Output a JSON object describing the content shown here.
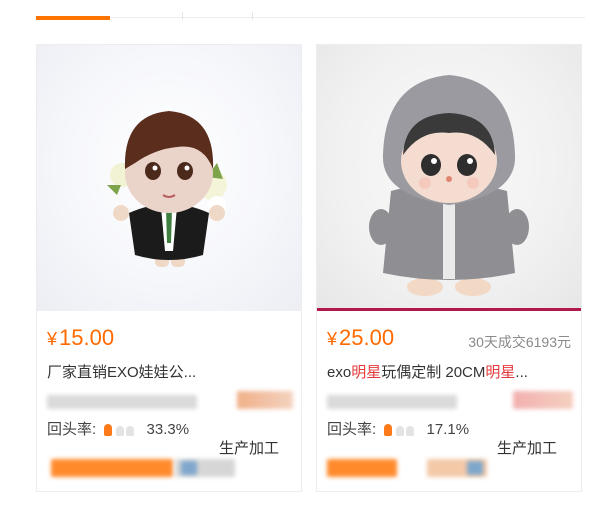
{
  "products": [
    {
      "price_symbol": "¥",
      "price": "15.00",
      "sales": "",
      "title": "厂家直销EXO娃娃公...",
      "return_rate_label": "回头率:",
      "return_rate_value": "33.3%",
      "service_label": "生产加工"
    },
    {
      "price_symbol": "¥",
      "price": "25.00",
      "sales": "30天成交6193元",
      "title_parts": [
        "exo",
        "明星",
        "玩偶定制 20CM",
        "明星",
        "..."
      ],
      "return_rate_label": "回头率:",
      "return_rate_value": "17.1%",
      "service_label": "生产加工"
    }
  ],
  "colors": {
    "accent": "#ff6a00",
    "tab_active": "#ff7300",
    "highlight": "#e4393c"
  }
}
